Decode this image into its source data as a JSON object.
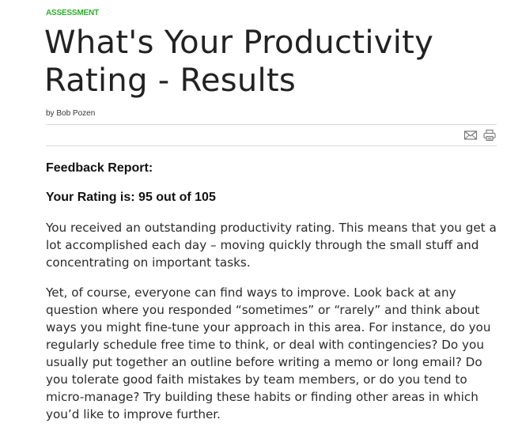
{
  "article": {
    "kicker": "ASSESSMENT",
    "title": "What's Your Productivity Rating - Results",
    "byline": "by Bob Pozen"
  },
  "toolbar": {
    "email_icon": "envelope-icon",
    "print_icon": "printer-icon"
  },
  "report": {
    "heading": "Feedback Report:",
    "rating_label": "Your Rating is: 95 out of 105",
    "paragraphs": [
      "You received an outstanding productivity rating. This means that you get a lot accomplished each day – moving quickly through the small stuff and concentrating on important tasks.",
      "Yet, of course, everyone can find ways to improve. Look back at any question where you responded “sometimes” or “rarely” and think about ways you might fine-tune your approach in this area. For instance, do you regularly schedule free time to think, or deal with contingencies? Do you usually put together an outline before writing a memo or long email? Do you tolerate good faith mistakes by team members, or do you tend to micro-manage? Try building these habits or finding other areas in which you’d like to improve further."
    ]
  },
  "colors": {
    "kicker": "#2bb02b",
    "text": "#222222",
    "rule": "#d8d8d8",
    "icon": "#777777"
  }
}
